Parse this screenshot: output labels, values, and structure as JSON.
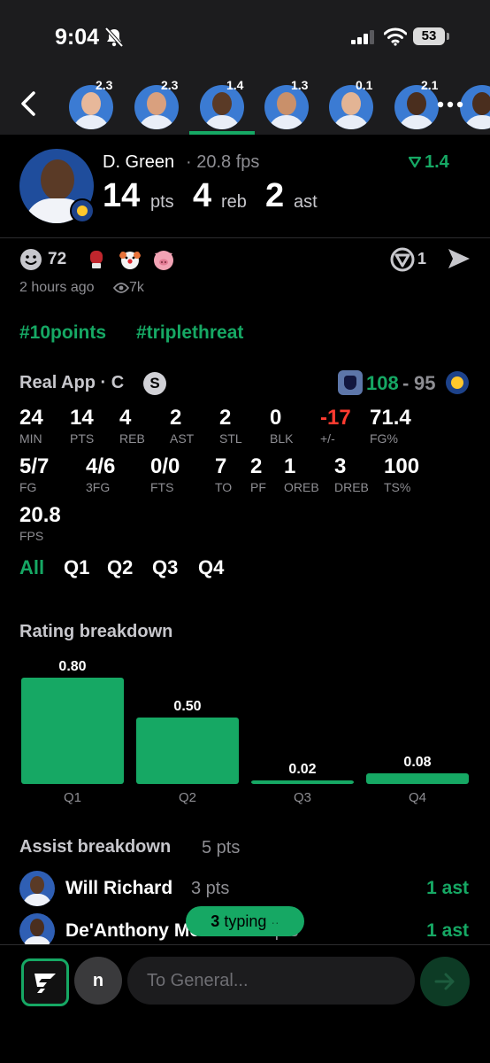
{
  "status": {
    "time": "9:04",
    "battery": "53"
  },
  "strip": {
    "players": [
      {
        "score": "2.3",
        "skin": "#e7b89a"
      },
      {
        "score": "2.3",
        "skin": "#d9a07e"
      },
      {
        "score": "1.4",
        "skin": "#5a3a26"
      },
      {
        "score": "1.3",
        "skin": "#c9906a"
      },
      {
        "score": "0.1",
        "skin": "#e3b494"
      },
      {
        "score": "2.1",
        "skin": "#4a2e1e"
      },
      {
        "score": "",
        "skin": "#4a2e1e"
      }
    ]
  },
  "player": {
    "name": "D. Green",
    "fps_text": "· 20.8 fps",
    "delta": "1.4",
    "pts": "14",
    "pts_label": "pts",
    "reb": "4",
    "reb_label": "reb",
    "ast": "2",
    "ast_label": "ast"
  },
  "reactions": {
    "count": "72",
    "votes": "1",
    "time": "2 hours ago",
    "views": "7k"
  },
  "hashtags": [
    "#10points",
    "#triplethreat"
  ],
  "game": {
    "source": "Real App · C",
    "badge": "S",
    "team_score": "108",
    "dash": "-",
    "opp_score": "95",
    "stats": [
      {
        "value": "24",
        "label": "MIN"
      },
      {
        "value": "14",
        "label": "PTS"
      },
      {
        "value": "4",
        "label": "REB"
      },
      {
        "value": "2",
        "label": "AST"
      },
      {
        "value": "2",
        "label": "STL"
      },
      {
        "value": "0",
        "label": "BLK"
      },
      {
        "value": "-17",
        "label": "+/-"
      },
      {
        "value": "71.4",
        "label": "FG%"
      },
      {
        "value": "5/7",
        "label": "FG"
      },
      {
        "value": "4/6",
        "label": "3FG"
      },
      {
        "value": "0/0",
        "label": "FTS"
      },
      {
        "value": "7",
        "label": "TO"
      },
      {
        "value": "2",
        "label": "PF"
      },
      {
        "value": "1",
        "label": "OREB"
      },
      {
        "value": "3",
        "label": "DREB"
      },
      {
        "value": "100",
        "label": "TS%"
      },
      {
        "value": "20.8",
        "label": "FPS"
      }
    ],
    "tabs": [
      "All",
      "Q1",
      "Q2",
      "Q3",
      "Q4"
    ]
  },
  "chart_title": "Rating breakdown",
  "chart_data": {
    "type": "bar",
    "title": "Rating breakdown",
    "categories": [
      "Q1",
      "Q2",
      "Q3",
      "Q4"
    ],
    "values": [
      0.8,
      0.5,
      0.02,
      0.08
    ],
    "value_labels": [
      "0.80",
      "0.50",
      "0.02",
      "0.08"
    ],
    "ylim": [
      0,
      0.8
    ],
    "color": "#16a864"
  },
  "assists": {
    "title": "Assist breakdown",
    "pts": "5 pts",
    "rows": [
      {
        "name": "Will Richard",
        "pts": "3 pts",
        "ast": "1 ast"
      },
      {
        "name": "De'Anthony Melton",
        "pts": "2 pts",
        "ast": "1 ast"
      }
    ]
  },
  "typing": {
    "count": "3",
    "label": "typing",
    "dots": "··"
  },
  "composer": {
    "user_initial": "n",
    "placeholder": "To General..."
  },
  "colors": {
    "accent": "#16a864",
    "negative": "#ff3b30",
    "background": "#000000"
  }
}
